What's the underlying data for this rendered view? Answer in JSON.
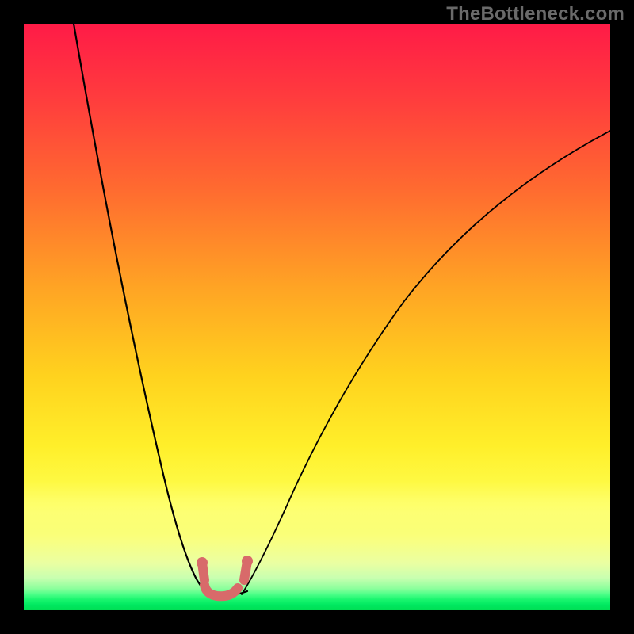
{
  "watermark": "TheBottleneck.com",
  "chart_data": {
    "type": "line",
    "title": "",
    "xlabel": "",
    "ylabel": "",
    "x": [
      0.0,
      0.05,
      0.1,
      0.15,
      0.2,
      0.25,
      0.28,
      0.3,
      0.32,
      0.34,
      0.36,
      0.38,
      0.42,
      0.48,
      0.55,
      0.65,
      0.75,
      0.85,
      1.0
    ],
    "y": [
      1.0,
      0.78,
      0.56,
      0.35,
      0.18,
      0.08,
      0.035,
      0.02,
      0.01,
      0.005,
      0.01,
      0.02,
      0.06,
      0.14,
      0.25,
      0.41,
      0.55,
      0.68,
      0.82
    ],
    "xlim": [
      0,
      1
    ],
    "ylim": [
      0,
      1
    ],
    "background_gradient": [
      "#ff1b47",
      "#ff6a30",
      "#ffd21e",
      "#feff52",
      "#18f56e",
      "#00de54"
    ],
    "annotations": [
      {
        "type": "marker",
        "shape": "U",
        "color": "#d86a6a",
        "x_range": [
          0.3,
          0.38
        ],
        "y_range": [
          0.005,
          0.06
        ]
      }
    ]
  }
}
